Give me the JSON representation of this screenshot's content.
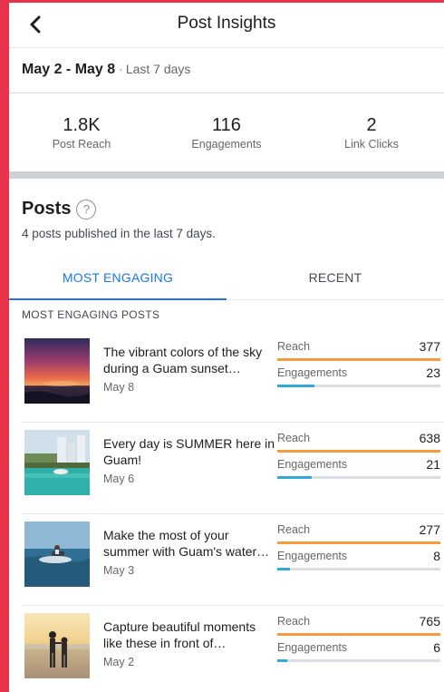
{
  "header": {
    "title": "Post Insights"
  },
  "date": {
    "range": "May 2 - May 8",
    "separator": "·",
    "period": "Last 7 days"
  },
  "stats": [
    {
      "value": "1.8K",
      "label": "Post Reach"
    },
    {
      "value": "116",
      "label": "Engagements"
    },
    {
      "value": "2",
      "label": "Link Clicks"
    }
  ],
  "posts_section": {
    "title": "Posts",
    "help": "?",
    "subtitle": "4 posts published in the last 7 days."
  },
  "tabs": [
    {
      "label": "MOST ENGAGING",
      "active": true
    },
    {
      "label": "RECENT",
      "active": false
    }
  ],
  "list_heading": "MOST ENGAGING POSTS",
  "colors": {
    "reach": "#f59a3f",
    "engagements": "#34a8d8",
    "accent": "#1877f2",
    "edge": "#e8344a"
  },
  "posts": [
    {
      "caption": "The vibrant colors of the sky during a Guam sunset…",
      "date": "May 8",
      "thumbnail": "sunset-photo",
      "reach_label": "Reach",
      "reach": "377",
      "reach_fill": 1.0,
      "eng_label": "Engagements",
      "engagements": "23",
      "eng_fill": 0.23
    },
    {
      "caption": "Every day is SUMMER here in Guam!",
      "date": "May 6",
      "thumbnail": "pool-photo",
      "reach_label": "Reach",
      "reach": "638",
      "reach_fill": 1.0,
      "eng_label": "Engagements",
      "engagements": "21",
      "eng_fill": 0.21
    },
    {
      "caption": "Make the most of your summer with Guam's water sports…",
      "date": "May 3",
      "thumbnail": "jetski-photo",
      "reach_label": "Reach",
      "reach": "277",
      "reach_fill": 1.0,
      "eng_label": "Engagements",
      "engagements": "8",
      "eng_fill": 0.08
    },
    {
      "caption": "Capture beautiful moments like these in front of…",
      "date": "May 2",
      "thumbnail": "kids-beach-photo",
      "reach_label": "Reach",
      "reach": "765",
      "reach_fill": 1.0,
      "eng_label": "Engagements",
      "engagements": "6",
      "eng_fill": 0.06
    }
  ]
}
